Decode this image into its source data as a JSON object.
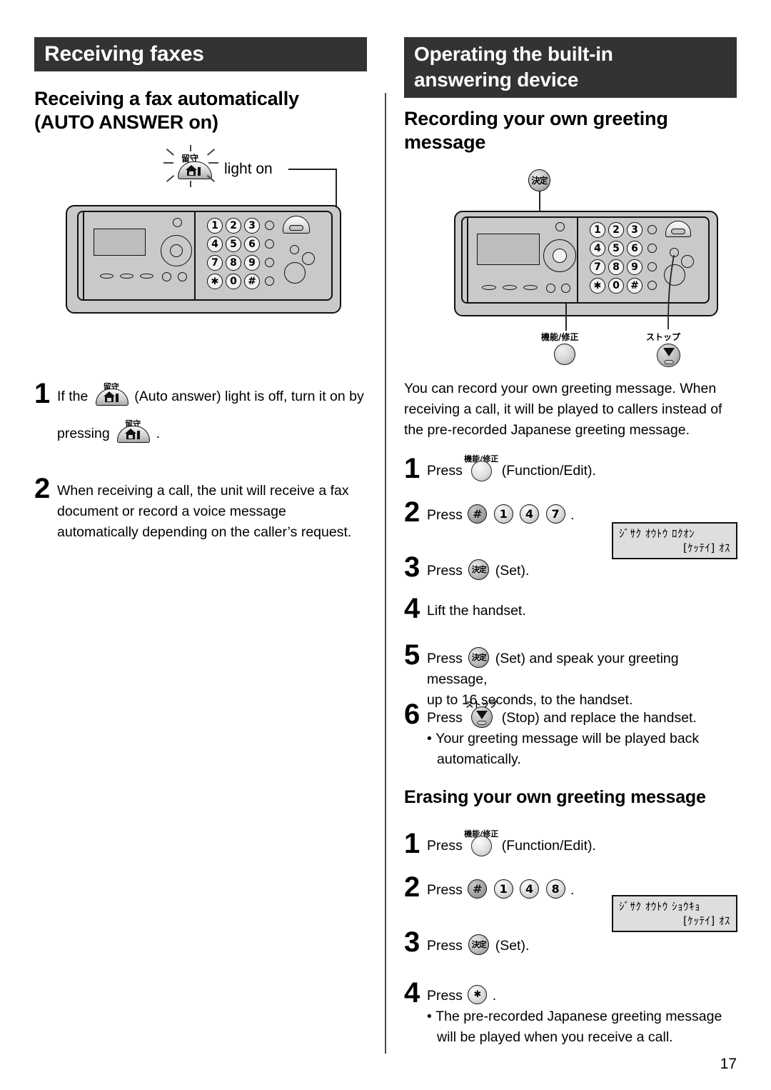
{
  "page": {
    "number": "17"
  },
  "left_column": {
    "section_bar": "Receiving faxes",
    "subheading_line1": "Receiving a fax automatically",
    "subheading_line2": "(AUTO ANSWER on)",
    "illustration": {
      "callout_label": "light on",
      "button_jp_label": "留守",
      "keypad": [
        "1",
        "2",
        "3",
        "4",
        "5",
        "6",
        "7",
        "8",
        "9",
        "✱",
        "0",
        "#"
      ]
    },
    "steps": [
      {
        "number": "1",
        "text_before": "If the",
        "icon": "auto-answer-dome-button",
        "text_after": "(Auto answer) light is off, turn it on by",
        "cont_before": "pressing",
        "cont_after": "."
      },
      {
        "number": "2",
        "text": "When receiving a call, the unit will receive a fax document or record a voice message automatically depending on the caller’s request."
      }
    ]
  },
  "right_column": {
    "section_bar_line1": "Operating the built-in",
    "section_bar_line2": "answering device",
    "subheading_line1": "Recording your own greeting",
    "subheading_line2": "message",
    "illustration": {
      "set_button_jp": "決定",
      "function_button_jp": "機能/修正",
      "stop_button_jp": "ストップ",
      "keypad": [
        "1",
        "2",
        "3",
        "4",
        "5",
        "6",
        "7",
        "8",
        "9",
        "✱",
        "0",
        "#"
      ]
    },
    "intro": "You can record your own greeting message. When receiving a call, it will be played to callers instead of the pre-recorded Japanese greeting message.",
    "record_steps": [
      {
        "number": "1",
        "before": "Press",
        "button_label": "機能/修正",
        "after": "(Function/Edit)."
      },
      {
        "number": "2",
        "before": "Press",
        "keys": [
          "#",
          "1",
          "4",
          "7"
        ],
        "after": "."
      },
      {
        "number": "3",
        "before": "Press",
        "button_label": "決定",
        "after": "(Set)."
      },
      {
        "number": "4",
        "text": "Lift the handset."
      },
      {
        "number": "5",
        "before": "Press",
        "button_label": "決定",
        "after": "(Set) and speak your greeting message,",
        "cont": "up to 16 seconds, to the handset."
      },
      {
        "number": "6",
        "before": "Press",
        "button_label": "ストップ",
        "after": "(Stop) and replace the handset.",
        "bullet": "Your greeting message will be played back automatically."
      }
    ],
    "record_lcd": {
      "line1": "ｼﾞｻｸ ｵｳﾄｳ ﾛｸｵﾝ",
      "line2": "[ｹｯﾃｲ] ｵｽ"
    },
    "erase_heading": "Erasing your own greeting message",
    "erase_steps": [
      {
        "number": "1",
        "before": "Press",
        "button_label": "機能/修正",
        "after": "(Function/Edit)."
      },
      {
        "number": "2",
        "before": "Press",
        "keys": [
          "#",
          "1",
          "4",
          "8"
        ],
        "after": "."
      },
      {
        "number": "3",
        "before": "Press",
        "button_label": "決定",
        "after": "(Set)."
      },
      {
        "number": "4",
        "before": "Press",
        "keys": [
          "✱"
        ],
        "after": ".",
        "bullet": "The pre-recorded Japanese greeting message will be played when you receive a call."
      }
    ],
    "erase_lcd": {
      "line1": "ｼﾞｻｸ ｵｳﾄｳ ｼｮｳｷｮ",
      "line2": "[ｹｯﾃｲ] ｵｽ"
    }
  }
}
